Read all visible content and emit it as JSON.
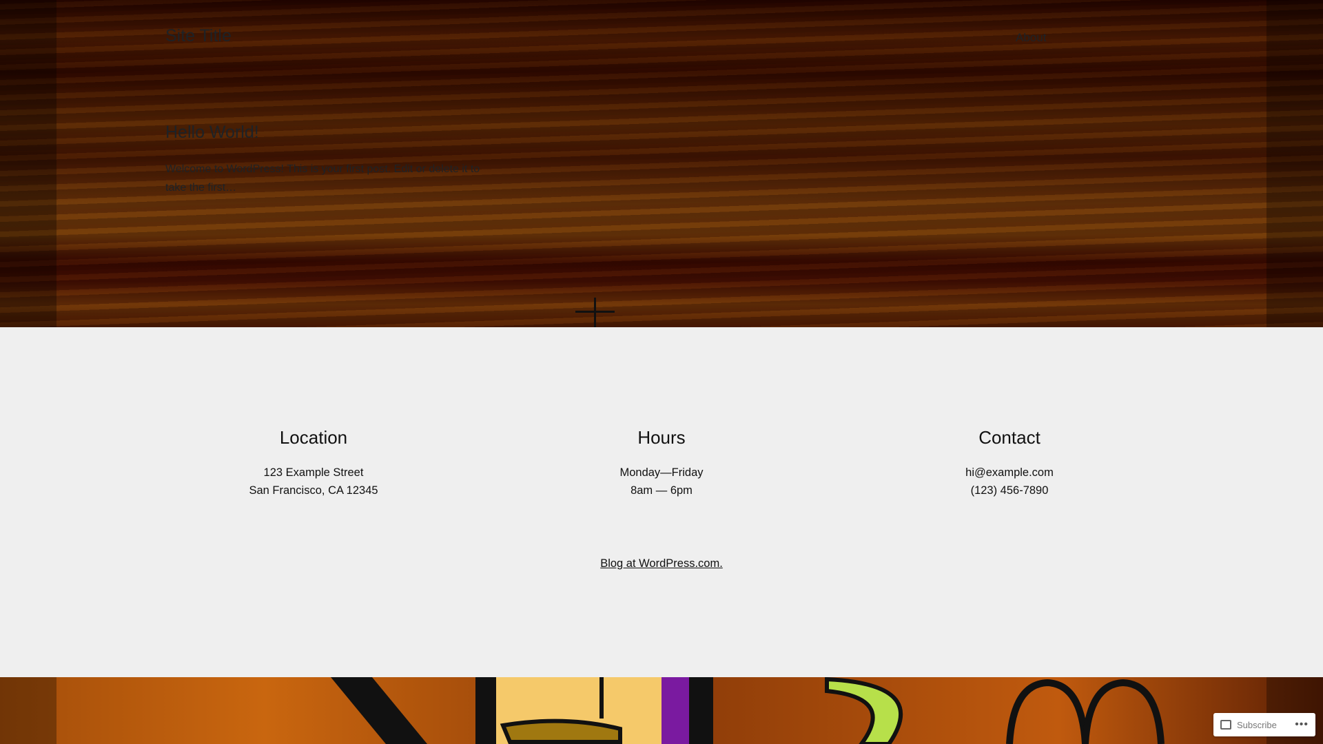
{
  "header": {
    "site_title": "Site Title",
    "nav": [
      {
        "label": "About"
      }
    ]
  },
  "post": {
    "title": "Hello World!",
    "excerpt": "Welcome to WordPress! This is your first post. Edit or delete it to take the first…"
  },
  "footer": {
    "columns": [
      {
        "heading": "Location",
        "lines": [
          "123 Example Street",
          "San Francisco, CA 12345"
        ]
      },
      {
        "heading": "Hours",
        "lines": [
          "Monday—Friday",
          "8am — 6pm"
        ]
      },
      {
        "heading": "Contact",
        "lines": [
          "hi@example.com",
          "(123) 456-7890"
        ]
      }
    ],
    "credit": "Blog at WordPress.com."
  },
  "subscribe": {
    "label": "Subscribe",
    "more": "•••"
  }
}
